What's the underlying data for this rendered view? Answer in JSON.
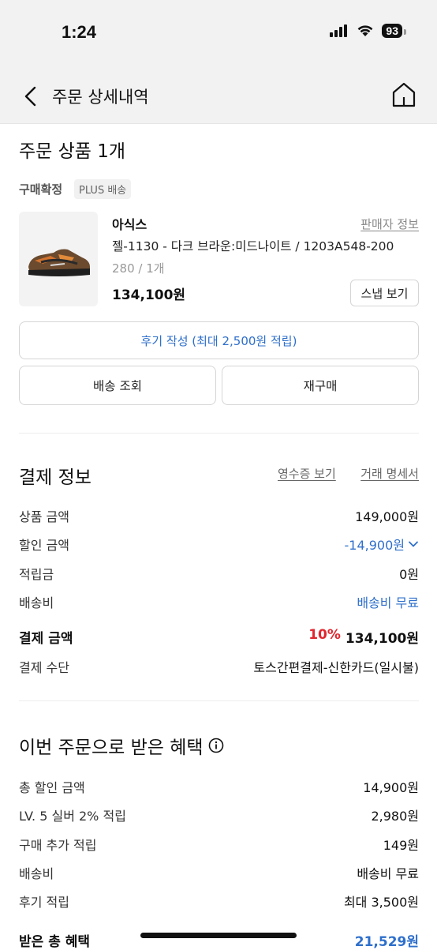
{
  "status_bar": {
    "time": "1:24",
    "battery": "93"
  },
  "nav": {
    "title": "주문 상세내역"
  },
  "order_products": {
    "title": "주문 상품 1개",
    "status": "구매확정",
    "badge": "PLUS 배송",
    "brand": "아식스",
    "seller_info": "판매자 정보",
    "product_name": "젤-1130 - 다크 브라운:미드나이트 / 1203A548-200",
    "option": "280 / 1개",
    "price": "134,100원",
    "snap_button": "스냅 보기",
    "review_button": "후기 작성  (최대 2,500원 적립)",
    "track_button": "배송 조회",
    "reorder_button": "재구매"
  },
  "payment": {
    "title": "결제 정보",
    "receipt_link": "영수증 보기",
    "statement_link": "거래 명세서",
    "rows": [
      {
        "label": "상품 금액",
        "value": "149,000원"
      },
      {
        "label": "할인 금액",
        "value": "-14,900원"
      },
      {
        "label": "적립금",
        "value": "0원"
      },
      {
        "label": "배송비",
        "value": "배송비 무료"
      }
    ],
    "total_label": "결제 금액",
    "total_discount": "10%",
    "total_value": "134,100원",
    "method_label": "결제 수단",
    "method_value": "토스간편결제-신한카드(일시불)"
  },
  "benefits": {
    "title": "이번 주문으로 받은 혜택",
    "rows": [
      {
        "label": "총 할인 금액",
        "value": "14,900원"
      },
      {
        "label": "LV. 5 실버 2% 적립",
        "value": "2,980원"
      },
      {
        "label": "구매 추가 적립",
        "value": "149원"
      },
      {
        "label": "배송비",
        "value": "배송비 무료"
      },
      {
        "label": "후기 적립",
        "value": "최대 3,500원"
      }
    ],
    "total_label": "받은 총 혜택",
    "total_value": "21,529원"
  },
  "colors": {
    "accent_blue": "#2e6fcb",
    "discount_red": "#e0262e"
  },
  "icons": [
    "signal-icon",
    "wifi-icon",
    "battery-icon",
    "back-icon",
    "home-icon",
    "chevron-down-icon",
    "info-icon"
  ]
}
